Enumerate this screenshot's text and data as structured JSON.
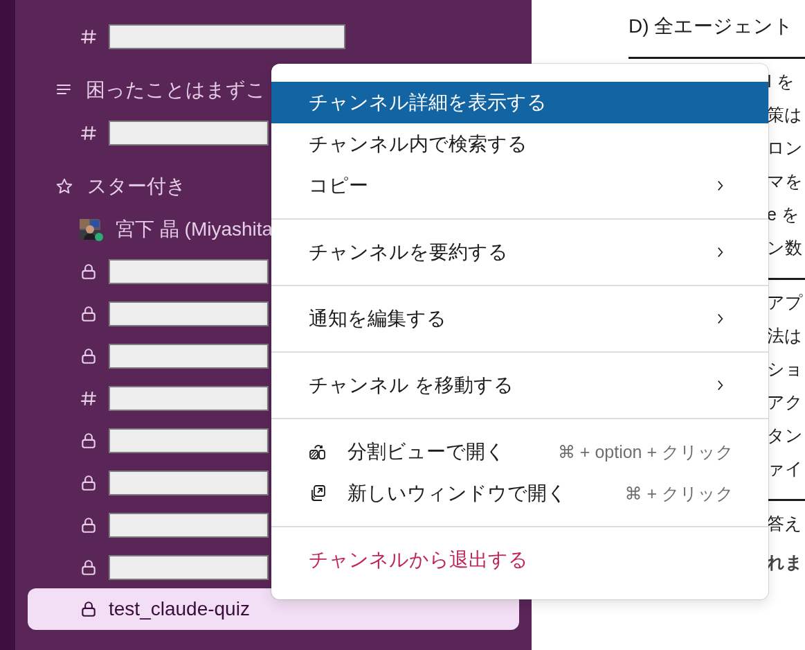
{
  "sidebar": {
    "items": [
      {
        "kind": "public-channel",
        "selected": false
      },
      {
        "kind": "custom-section",
        "label": "困ったことはまずこ"
      },
      {
        "kind": "public-channel",
        "selected": false
      },
      {
        "kind": "starred-section",
        "label": "スター付き"
      },
      {
        "kind": "dm",
        "label": "宮下 晶 (Miyashita",
        "online": true
      },
      {
        "kind": "private-channel",
        "selected": false
      },
      {
        "kind": "private-channel",
        "selected": false
      },
      {
        "kind": "private-channel",
        "selected": false
      },
      {
        "kind": "public-channel",
        "selected": false
      },
      {
        "kind": "private-channel",
        "selected": false
      },
      {
        "kind": "private-channel",
        "selected": false
      },
      {
        "kind": "private-channel",
        "selected": false
      },
      {
        "kind": "private-channel",
        "selected": false
      },
      {
        "kind": "private-channel",
        "label": "test_claude-quiz",
        "selected": true
      }
    ]
  },
  "content": {
    "heading": "D) 全エージェント",
    "blocks": [
      {
        "lines": [
          {
            "text": "I を",
            "bold": false
          },
          {
            "text": "策は",
            "bold": false
          },
          {
            "text": "ロン",
            "bold": false
          },
          {
            "text": "マを",
            "bold": false
          },
          {
            "text": "e を",
            "bold": false
          },
          {
            "text": "ン数",
            "bold": false
          }
        ]
      },
      {
        "lines": [
          {
            "text": "アプ",
            "bold": false
          },
          {
            "text": "法は",
            "bold": false
          },
          {
            "text": "ショ",
            "bold": false
          },
          {
            "text": "アク",
            "bold": false
          },
          {
            "text": "タン",
            "bold": false
          },
          {
            "text": "ァイ",
            "bold": false
          }
        ]
      },
      {
        "lines": [
          {
            "text": "答え",
            "bold": false
          },
          {
            "text": "れま",
            "bold": true
          }
        ]
      }
    ]
  },
  "menu": {
    "groups": [
      [
        {
          "kind": "text",
          "label": "チャンネル詳細を表示する",
          "selected": true,
          "submenu": false,
          "danger": false
        },
        {
          "kind": "text",
          "label": "チャンネル内で検索する",
          "selected": false,
          "submenu": false,
          "danger": false
        },
        {
          "kind": "text",
          "label": "コピー",
          "selected": false,
          "submenu": true,
          "danger": false
        }
      ],
      [
        {
          "kind": "text",
          "label": "チャンネルを要約する",
          "selected": false,
          "submenu": true,
          "danger": false
        }
      ],
      [
        {
          "kind": "text",
          "label": "通知を編集する",
          "selected": false,
          "submenu": true,
          "danger": false
        }
      ],
      [
        {
          "kind": "text",
          "label": "チャンネル を移動する",
          "selected": false,
          "submenu": true,
          "danger": false
        }
      ],
      [
        {
          "kind": "split-view",
          "label": "分割ビューで開く",
          "shortcut": "⌘ + option + クリック",
          "selected": false,
          "submenu": false,
          "danger": false
        },
        {
          "kind": "new-window",
          "label": "新しいウィンドウで開く",
          "shortcut": "⌘ + クリック",
          "selected": false,
          "submenu": false,
          "danger": false
        }
      ],
      [
        {
          "kind": "text",
          "label": "チャンネルから退出する",
          "selected": false,
          "submenu": false,
          "danger": true
        }
      ]
    ]
  }
}
